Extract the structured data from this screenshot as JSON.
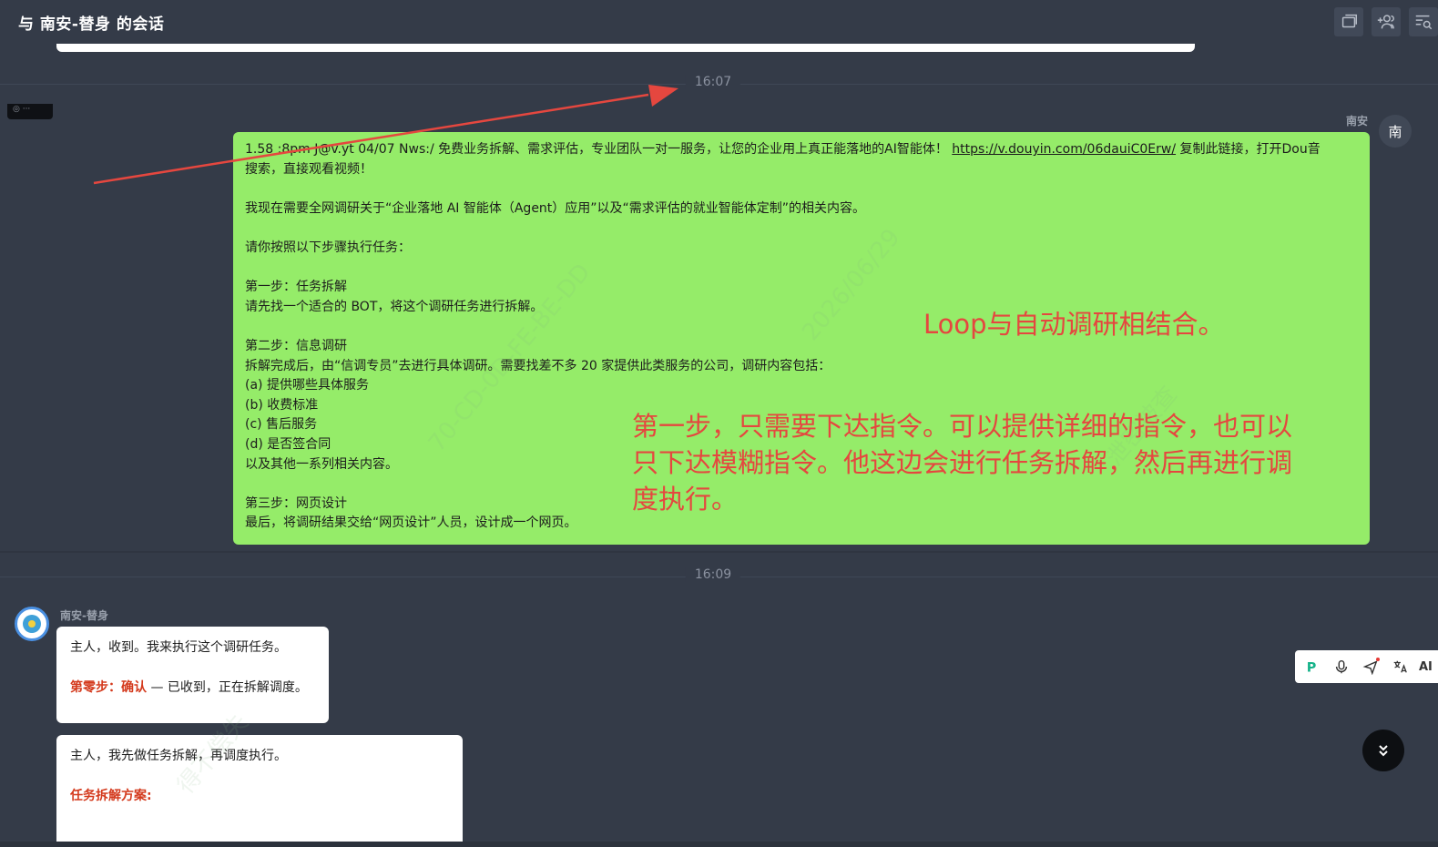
{
  "header": {
    "title": "与 南安-替身 的会话",
    "actions": [
      "window-icon",
      "add-member-icon",
      "search-history-icon"
    ]
  },
  "timestamps": {
    "first": "16:07",
    "second": "16:09"
  },
  "corner_badge": {
    "text": "◎ ···"
  },
  "right_message": {
    "sender": "南安",
    "avatar_text": "南",
    "bubble_color": "#95ec69",
    "lines": [
      "1.58 :8pm J@v.yt 04/07 Nws:/ 免费业务拆解、需求评估，专业团队一对一服务，让您的企业用上真正能落地的AI智能体！ ",
      "搜索，直接观看视频！",
      "",
      "我现在需要全网调研关于“企业落地 AI 智能体（Agent）应用”以及“需求评估的就业智能体定制”的相关内容。",
      "",
      "请你按照以下步骤执行任务：",
      "",
      "第一步：任务拆解",
      "请先找一个适合的 BOT，将这个调研任务进行拆解。",
      "",
      "第二步：信息调研",
      "拆解完成后，由“信调专员”去进行具体调研。需要找差不多 20 家提供此类服务的公司，调研内容包括：",
      "(a) 提供哪些具体服务",
      "(b) 收费标准",
      "(c) 售后服务",
      "(d) 是否签合同",
      "以及其他一系列相关内容。",
      "",
      "第三步：网页设计",
      "最后，将调研结果交给“网页设计”人员，设计成一个网页。"
    ],
    "link": "https://v.douyin.com/06dauiC0Erw/",
    "link_suffix": " 复制此链接，打开Dou音"
  },
  "annotations": {
    "note1": "Loop与自动调研相结合。",
    "note2": "第一步，只需要下达指令。可以提供详细的指令，也可以只下达模糊指令。他这边会进行任务拆解，然后再进行调度执行。",
    "color": "#e5473f"
  },
  "left_messages": {
    "sender": "南安-替身",
    "bubble1": {
      "line1": "主人，收到。我来执行这个调研任务。",
      "line3_label": "第零步：确认",
      "line3_text": " — 已收到，正在拆解调度。"
    },
    "bubble2": {
      "line1": "主人，我先做任务拆解，再调度执行。",
      "line3_label": "任务拆解方案:"
    }
  },
  "float_toolbar": {
    "items": [
      "p-logo-icon",
      "microphone-icon",
      "send-icon",
      "translate-icon"
    ],
    "ai_label": "AI"
  },
  "watermarks": [
    "70-CD-0D-FE-BE-DD",
    "2026/06/29",
    "泄密被查",
    "得不偿失"
  ]
}
